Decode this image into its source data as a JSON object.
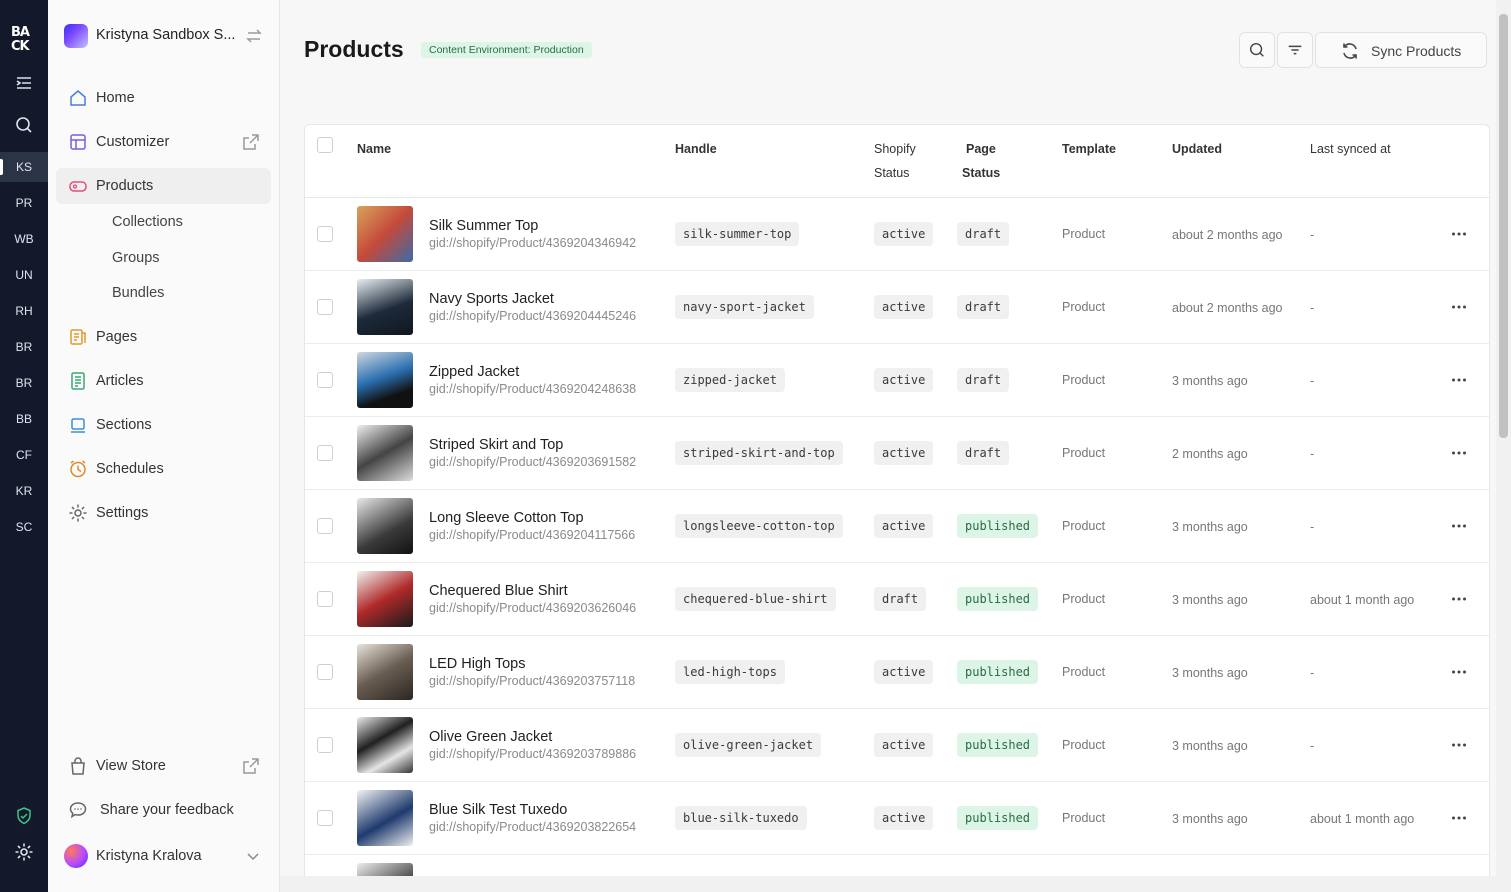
{
  "rail": {
    "logo": "BA CK",
    "workspaces": [
      "KS",
      "PR",
      "WB",
      "UN",
      "RH",
      "BR",
      "BR",
      "BB",
      "CF",
      "KR",
      "SC"
    ]
  },
  "sidebar": {
    "store_name": "Kristyna Sandbox S...",
    "nav": {
      "home": "Home",
      "customizer": "Customizer",
      "products": "Products",
      "collections": "Collections",
      "groups": "Groups",
      "bundles": "Bundles",
      "pages": "Pages",
      "articles": "Articles",
      "sections": "Sections",
      "schedules": "Schedules",
      "settings": "Settings"
    },
    "view_store": "View Store",
    "feedback": "Share your feedback",
    "user_name": "Kristyna Kralova"
  },
  "header": {
    "title": "Products",
    "env_badge": "Content Environment: Production",
    "sync_label": "Sync Products"
  },
  "table": {
    "columns": {
      "name": "Name",
      "handle": "Handle",
      "shopify_status_1": "Shopify",
      "shopify_status_2": "Status",
      "page_status_1": "Page",
      "page_status_2": "Status",
      "template": "Template",
      "updated": "Updated",
      "last_synced": "Last synced at"
    },
    "rows": [
      {
        "name": "Silk Summer Top",
        "gid": "gid://shopify/Product/4369204346942",
        "handle": "silk-summer-top",
        "shopify_status": "active",
        "page_status": "draft",
        "template": "Product",
        "updated": "about 2 months ago",
        "last_synced": "-"
      },
      {
        "name": "Navy Sports Jacket",
        "gid": "gid://shopify/Product/4369204445246",
        "handle": "navy-sport-jacket",
        "shopify_status": "active",
        "page_status": "draft",
        "template": "Product",
        "updated": "about 2 months ago",
        "last_synced": "-"
      },
      {
        "name": "Zipped Jacket",
        "gid": "gid://shopify/Product/4369204248638",
        "handle": "zipped-jacket",
        "shopify_status": "active",
        "page_status": "draft",
        "template": "Product",
        "updated": "3 months ago",
        "last_synced": "-"
      },
      {
        "name": "Striped Skirt and Top",
        "gid": "gid://shopify/Product/4369203691582",
        "handle": "striped-skirt-and-top",
        "shopify_status": "active",
        "page_status": "draft",
        "template": "Product",
        "updated": "2 months ago",
        "last_synced": "-"
      },
      {
        "name": "Long Sleeve Cotton Top",
        "gid": "gid://shopify/Product/4369204117566",
        "handle": "longsleeve-cotton-top",
        "shopify_status": "active",
        "page_status": "published",
        "template": "Product",
        "updated": "3 months ago",
        "last_synced": "-"
      },
      {
        "name": "Chequered Blue Shirt",
        "gid": "gid://shopify/Product/4369203626046",
        "handle": "chequered-blue-shirt",
        "shopify_status": "draft",
        "page_status": "published",
        "template": "Product",
        "updated": "3 months ago",
        "last_synced": "about 1 month ago"
      },
      {
        "name": "LED High Tops",
        "gid": "gid://shopify/Product/4369203757118",
        "handle": "led-high-tops",
        "shopify_status": "active",
        "page_status": "published",
        "template": "Product",
        "updated": "3 months ago",
        "last_synced": "-"
      },
      {
        "name": "Olive Green Jacket",
        "gid": "gid://shopify/Product/4369203789886",
        "handle": "olive-green-jacket",
        "shopify_status": "active",
        "page_status": "published",
        "template": "Product",
        "updated": "3 months ago",
        "last_synced": "-"
      },
      {
        "name": "Blue Silk Test Tuxedo",
        "gid": "gid://shopify/Product/4369203822654",
        "handle": "blue-silk-tuxedo",
        "shopify_status": "active",
        "page_status": "published",
        "template": "Product",
        "updated": "3 months ago",
        "last_synced": "about 1 month ago"
      }
    ]
  },
  "colors": {
    "rail_bg": "#13192b",
    "published_bg": "#dcf5e7",
    "published_text": "#2b6b45"
  }
}
